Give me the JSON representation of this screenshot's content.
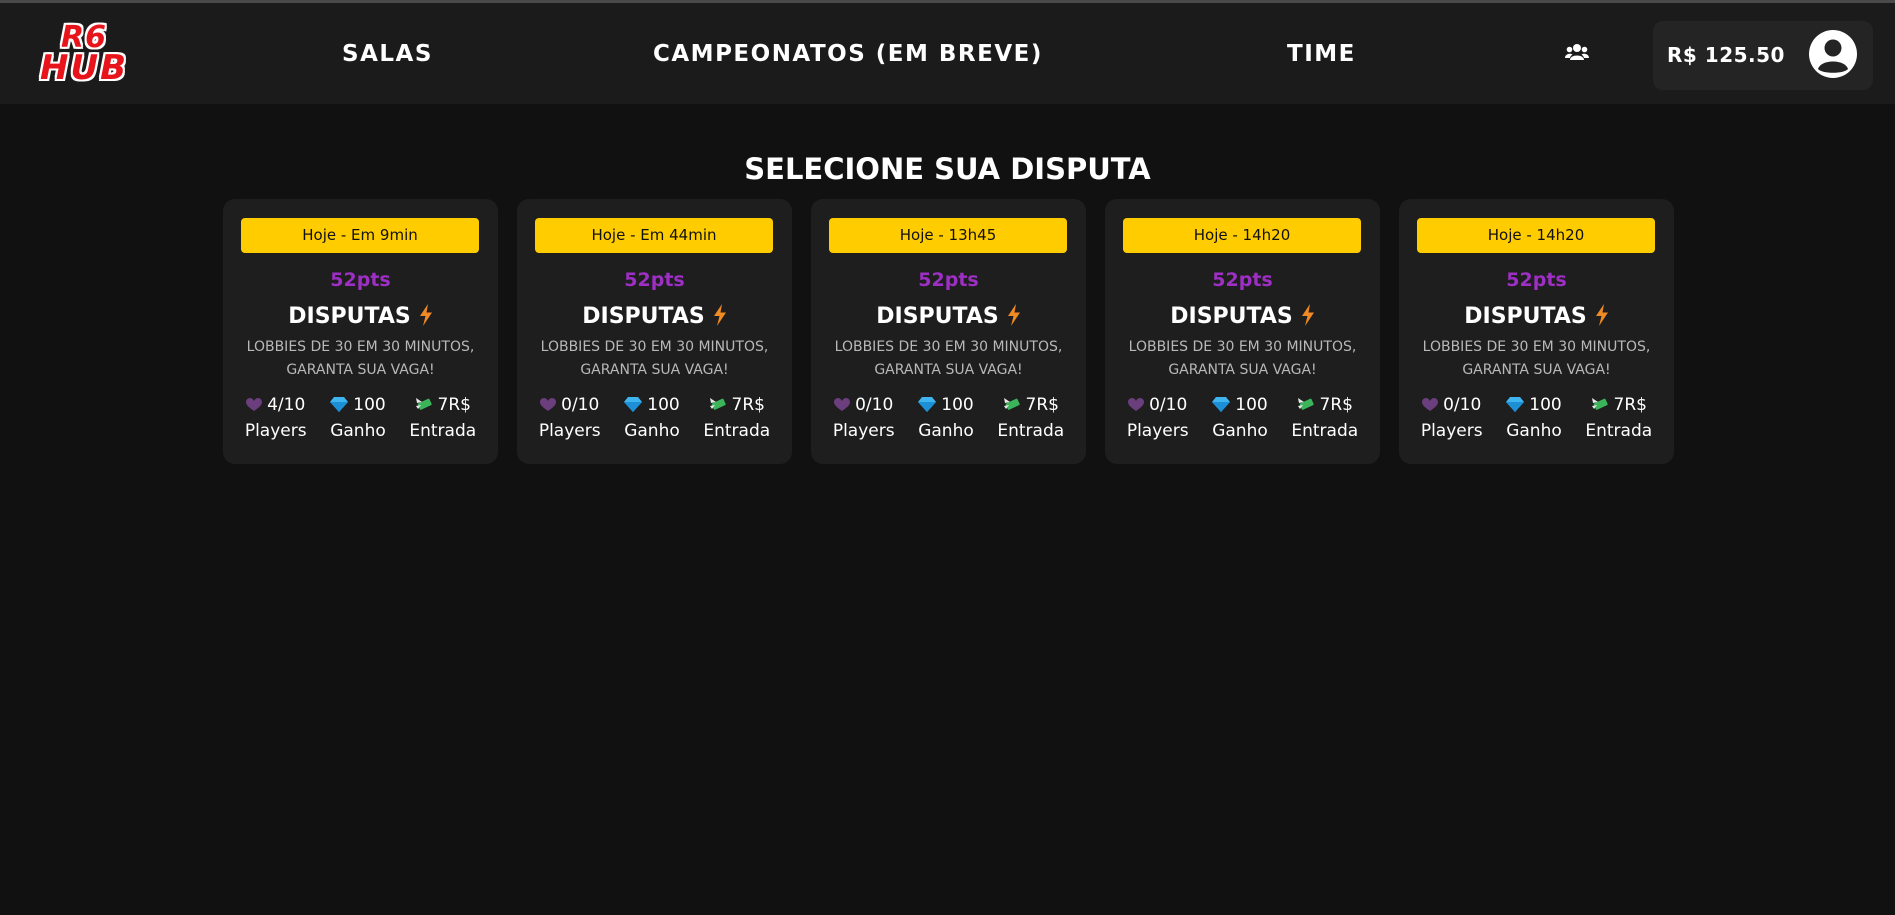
{
  "logo": {
    "line1": "R6",
    "line2": "HUB"
  },
  "nav": {
    "salas": "SALAS",
    "campeonatos": "CAMPEONATOS (EM BREVE)",
    "time": "TIME"
  },
  "wallet": {
    "balance": "R$ 125.50"
  },
  "page_title": "SELECIONE SUA DISPUTA",
  "colors": {
    "badge": "#ffcc00",
    "points": "#9d2fc4",
    "bolt": "#f08a24"
  },
  "cards": [
    {
      "time": "Hoje - Em 9min",
      "points": "52pts",
      "title": "DISPUTAS",
      "desc_line1": "LOBBIES DE 30 EM 30 MINUTOS,",
      "desc_line2": "GARANTA SUA VAGA!",
      "players": "4/10",
      "players_label": "Players",
      "ganho": "100",
      "ganho_label": "Ganho",
      "entrada": "7R$",
      "entrada_label": "Entrada"
    },
    {
      "time": "Hoje - Em 44min",
      "points": "52pts",
      "title": "DISPUTAS",
      "desc_line1": "LOBBIES DE 30 EM 30 MINUTOS,",
      "desc_line2": "GARANTA SUA VAGA!",
      "players": "0/10",
      "players_label": "Players",
      "ganho": "100",
      "ganho_label": "Ganho",
      "entrada": "7R$",
      "entrada_label": "Entrada"
    },
    {
      "time": "Hoje - 13h45",
      "points": "52pts",
      "title": "DISPUTAS",
      "desc_line1": "LOBBIES DE 30 EM 30 MINUTOS,",
      "desc_line2": "GARANTA SUA VAGA!",
      "players": "0/10",
      "players_label": "Players",
      "ganho": "100",
      "ganho_label": "Ganho",
      "entrada": "7R$",
      "entrada_label": "Entrada"
    },
    {
      "time": "Hoje - 14h20",
      "points": "52pts",
      "title": "DISPUTAS",
      "desc_line1": "LOBBIES DE 30 EM 30 MINUTOS,",
      "desc_line2": "GARANTA SUA VAGA!",
      "players": "0/10",
      "players_label": "Players",
      "ganho": "100",
      "ganho_label": "Ganho",
      "entrada": "7R$",
      "entrada_label": "Entrada"
    },
    {
      "time": "Hoje - 14h20",
      "points": "52pts",
      "title": "DISPUTAS",
      "desc_line1": "LOBBIES DE 30 EM 30 MINUTOS,",
      "desc_line2": "GARANTA SUA VAGA!",
      "players": "0/10",
      "players_label": "Players",
      "ganho": "100",
      "ganho_label": "Ganho",
      "entrada": "7R$",
      "entrada_label": "Entrada"
    }
  ]
}
